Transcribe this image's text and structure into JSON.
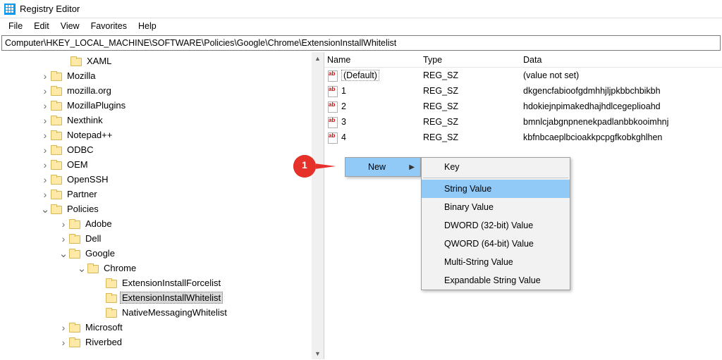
{
  "window": {
    "title": "Registry Editor"
  },
  "menu": {
    "file": "File",
    "edit": "Edit",
    "view": "View",
    "favorites": "Favorites",
    "help": "Help"
  },
  "address": "Computer\\HKEY_LOCAL_MACHINE\\SOFTWARE\\Policies\\Google\\Chrome\\ExtensionInstallWhitelist",
  "tree": [
    {
      "label": "XAML",
      "indent": 84,
      "twisty": ""
    },
    {
      "label": "Mozilla",
      "indent": 56,
      "twisty": ">"
    },
    {
      "label": "mozilla.org",
      "indent": 56,
      "twisty": ">"
    },
    {
      "label": "MozillaPlugins",
      "indent": 56,
      "twisty": ">"
    },
    {
      "label": "Nexthink",
      "indent": 56,
      "twisty": ">"
    },
    {
      "label": "Notepad++",
      "indent": 56,
      "twisty": ">"
    },
    {
      "label": "ODBC",
      "indent": 56,
      "twisty": ">"
    },
    {
      "label": "OEM",
      "indent": 56,
      "twisty": ">"
    },
    {
      "label": "OpenSSH",
      "indent": 56,
      "twisty": ">"
    },
    {
      "label": "Partner",
      "indent": 56,
      "twisty": ">"
    },
    {
      "label": "Policies",
      "indent": 56,
      "twisty": "v"
    },
    {
      "label": "Adobe",
      "indent": 82,
      "twisty": ">"
    },
    {
      "label": "Dell",
      "indent": 82,
      "twisty": ">"
    },
    {
      "label": "Google",
      "indent": 82,
      "twisty": "v"
    },
    {
      "label": "Chrome",
      "indent": 108,
      "twisty": "v"
    },
    {
      "label": "ExtensionInstallForcelist",
      "indent": 134,
      "twisty": ""
    },
    {
      "label": "ExtensionInstallWhitelist",
      "indent": 134,
      "twisty": "",
      "selected": true
    },
    {
      "label": "NativeMessagingWhitelist",
      "indent": 134,
      "twisty": ""
    },
    {
      "label": "Microsoft",
      "indent": 82,
      "twisty": ">"
    },
    {
      "label": "Riverbed",
      "indent": 82,
      "twisty": ">"
    }
  ],
  "columns": {
    "name": "Name",
    "type": "Type",
    "data": "Data"
  },
  "values": [
    {
      "name": "(Default)",
      "type": "REG_SZ",
      "data": "(value not set)",
      "default": true
    },
    {
      "name": "1",
      "type": "REG_SZ",
      "data": "dkgencfabioofgdmhhjljpkbbchbikbh"
    },
    {
      "name": "2",
      "type": "REG_SZ",
      "data": "hdokiejnpimakedhajhdlcegeplioahd"
    },
    {
      "name": "3",
      "type": "REG_SZ",
      "data": "bmnlcjabgnpnenekpadlanbbkooimhnj"
    },
    {
      "name": "4",
      "type": "REG_SZ",
      "data": "kbfnbcaeplbcioakkpcpgfkobkghlhen"
    }
  ],
  "context1": {
    "new": "New"
  },
  "context2": {
    "key": "Key",
    "string": "String Value",
    "binary": "Binary Value",
    "dword": "DWORD (32-bit) Value",
    "qword": "QWORD (64-bit) Value",
    "multi": "Multi-String Value",
    "expand": "Expandable String Value"
  },
  "callout": {
    "step": "1"
  }
}
